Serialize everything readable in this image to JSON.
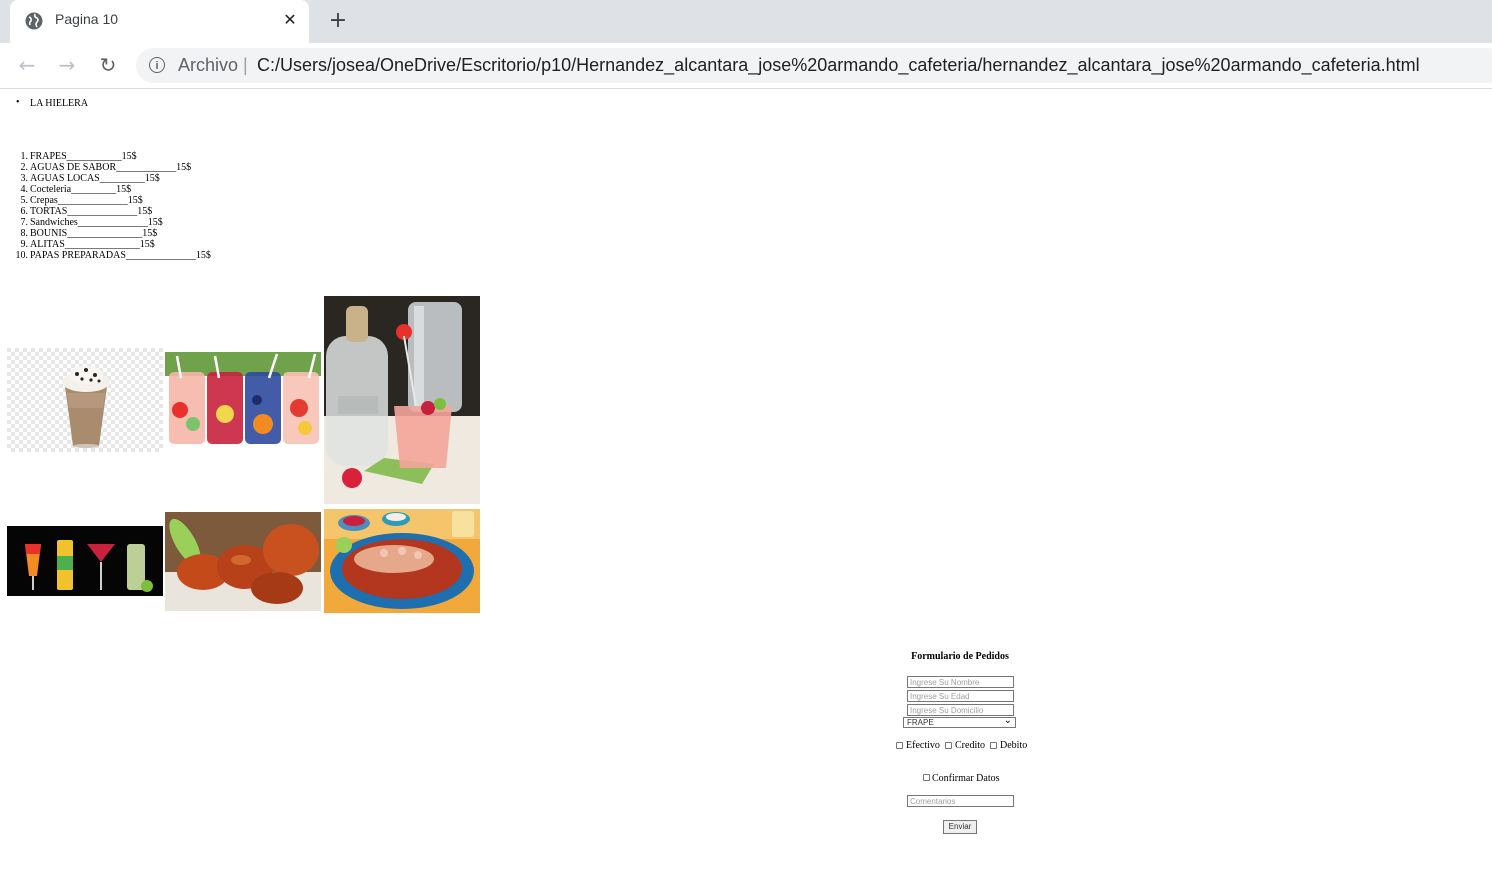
{
  "browser": {
    "tab_title": "Pagina 10",
    "scheme_label": "Archivo",
    "separator": "|",
    "url": "C:/Users/josea/OneDrive/Escritorio/p10/Hernandez_alcantara_jose%20armando_cafeteria/hernandez_alcantara_jose%20armando_cafeteria.html",
    "icons": [
      "globe-icon",
      "close-icon",
      "plus-icon",
      "back-arrow-icon",
      "forward-arrow-icon",
      "reload-icon",
      "info-icon"
    ]
  },
  "page": {
    "bullet_list": [
      "LA HIELERA"
    ],
    "menu": [
      {
        "num": "1.",
        "text": "FRAPES___________15$"
      },
      {
        "num": "2.",
        "text": "AGUAS DE SABOR____________15$"
      },
      {
        "num": "3.",
        "text": "AGUAS LOCAS_________15$"
      },
      {
        "num": "4.",
        "text": "Cocteleria_________15$"
      },
      {
        "num": "5.",
        "text": "Crepas______________15$"
      },
      {
        "num": "6.",
        "text": "TORTAS______________15$"
      },
      {
        "num": "7.",
        "text": "Sandwiches______________15$"
      },
      {
        "num": "8.",
        "text": "BOUNIS_______________15$"
      },
      {
        "num": "9.",
        "text": "ALITAS_______________15$"
      },
      {
        "num": "10.",
        "text": "PAPAS PREPARADAS______________15$"
      }
    ],
    "images": [
      "frappe-image",
      "fruit-waters-image",
      "cocktail-bottle-image",
      "cocktails-image",
      "chicken-wings-image",
      "prepared-potatoes-image"
    ],
    "form": {
      "title": "Formulario de Pedidos",
      "name_placeholder": "Ingrese Su Nombre",
      "age_placeholder": "Ingrese Su Edad",
      "address_placeholder": "Ingrese Su Domicilio",
      "select_value": "FRAPE",
      "payment": [
        "Efectivo",
        "Credito",
        "Debito"
      ],
      "confirm_label": "Confirmar Datos",
      "comments_placeholder": "Comentarios",
      "submit_label": "Enviar"
    }
  }
}
